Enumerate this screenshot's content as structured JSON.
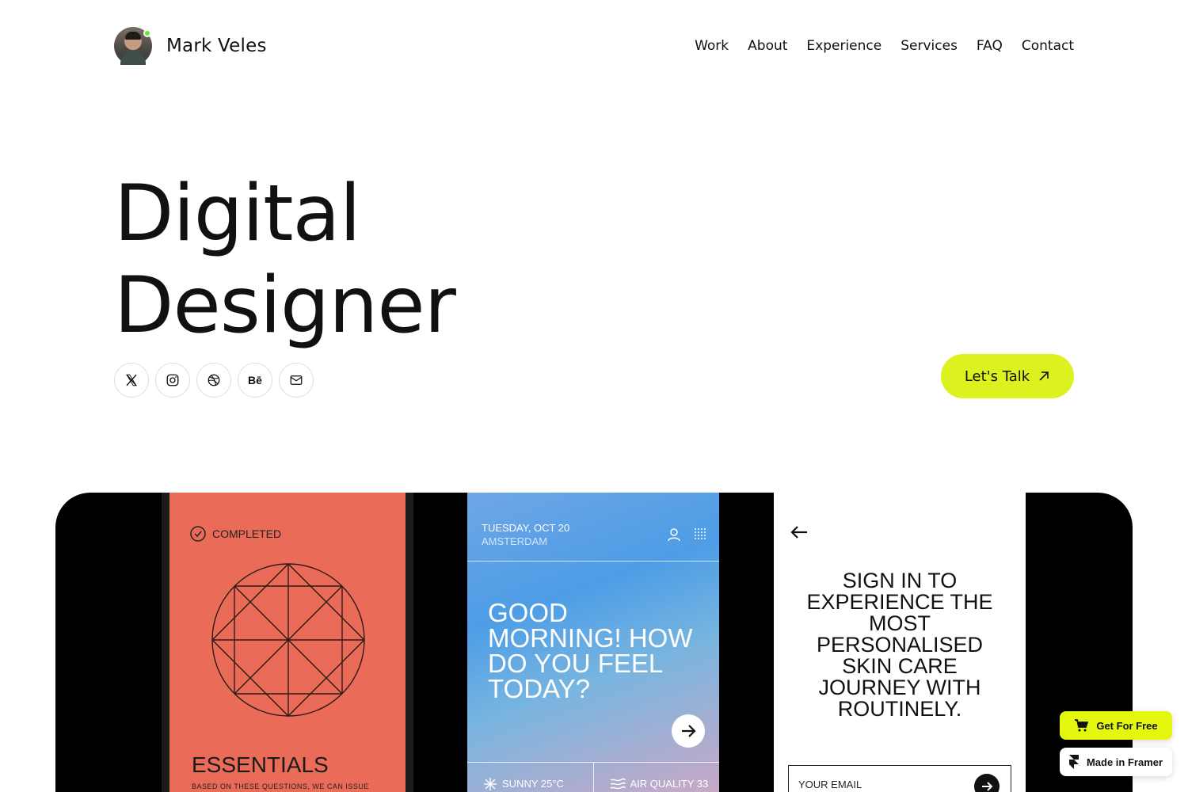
{
  "header": {
    "name": "Mark Veles",
    "nav": [
      "Work",
      "About",
      "Experience",
      "Services",
      "FAQ",
      "Contact"
    ]
  },
  "hero": {
    "title_line1": "Digital",
    "title_line2": "Designer",
    "cta_label": "Let's Talk"
  },
  "socials": [
    "x-icon",
    "instagram-icon",
    "dribbble-icon",
    "behance-icon",
    "mail-icon"
  ],
  "behance_label": "Bē",
  "showcase": {
    "card1": {
      "status": "COMPLETED",
      "title": "ESSENTIALS",
      "subtitle": "BASED ON THESE QUESTIONS, WE CAN ISSUE"
    },
    "card2": {
      "date": "TUESDAY, OCT 20",
      "city": "AMSTERDAM",
      "greeting": "GOOD MORNING! HOW DO YOU FEEL TODAY?",
      "weather": "SUNNY 25°C",
      "air": "AIR QUALITY 33"
    },
    "card3": {
      "headline": "SIGN IN TO EXPERIENCE THE MOST PERSONALISED SKIN CARE JOURNEY WITH ROUTINELY.",
      "email_placeholder": "YOUR EMAIL"
    }
  },
  "badges": {
    "get": "Get For Free",
    "framer": "Made in Framer"
  },
  "colors": {
    "accent": "#dcf21e",
    "card1_bg": "#e96b58",
    "card2_bg": "#4d9de6"
  }
}
